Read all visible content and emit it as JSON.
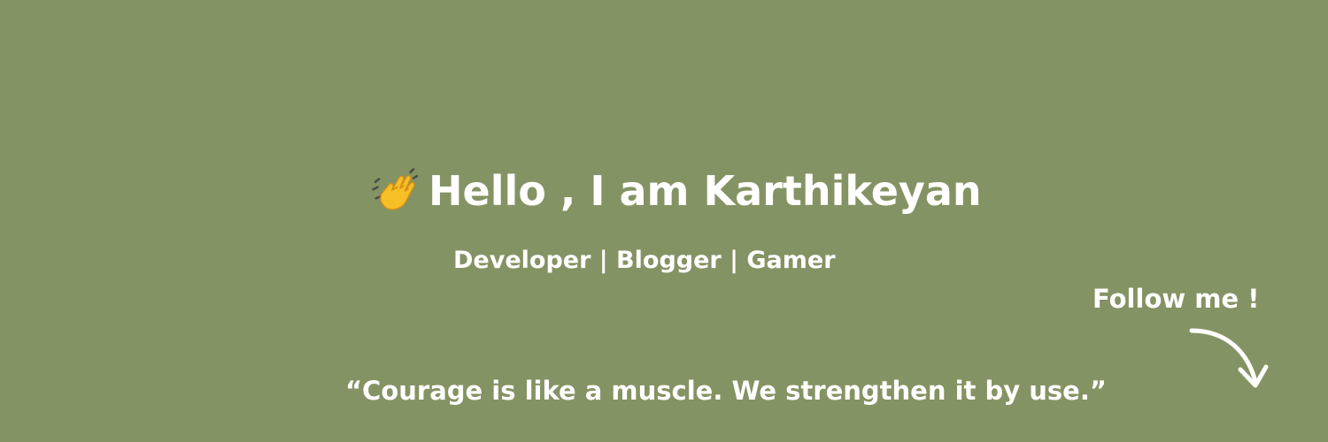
{
  "profile_banner": {
    "greeting": {
      "icon": "waving-hand-icon",
      "text": "Hello , I am Karthikeyan"
    },
    "roles": "Developer | Blogger | Gamer",
    "quote": "“Courage is like a muscle. We strengthen it by use.”",
    "call_to_action": {
      "text": "Follow me !",
      "icon": "curved-arrow-icon"
    }
  },
  "colors": {
    "background": "#849363",
    "text": "#ffffff",
    "wave_hand": "#f6bf26"
  }
}
